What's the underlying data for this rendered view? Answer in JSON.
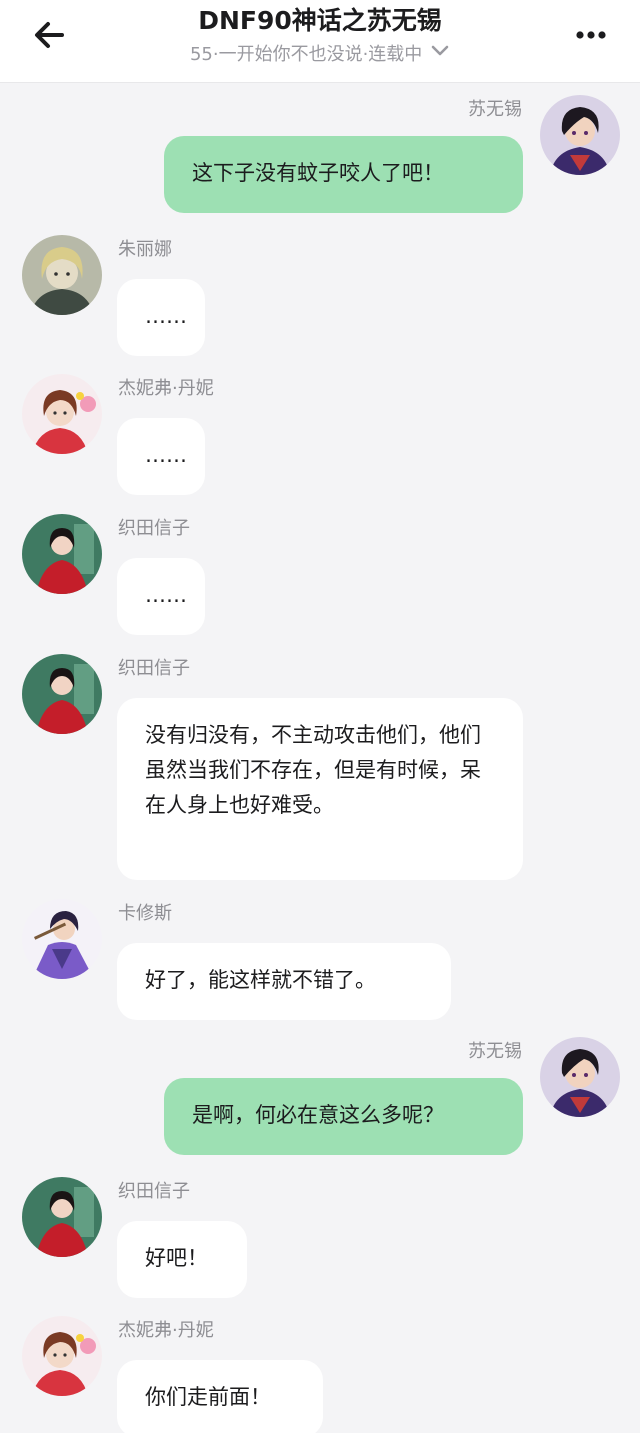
{
  "header": {
    "title": "DNF90神话之苏无锡",
    "subtitle": "55·一开始你不也没说·连载中"
  },
  "colors": {
    "self_bubble": "#9de0b3",
    "other_bubble": "#ffffff",
    "background": "#f4f4f6"
  },
  "messages": [
    {
      "sender": "苏无锡",
      "text": "这下子没有蚊子咬人了吧！",
      "side": "right",
      "avatar": "avatar-suwuxi"
    },
    {
      "sender": "朱丽娜",
      "text": "……",
      "side": "left",
      "avatar": "avatar-zhulina"
    },
    {
      "sender": "杰妮弗·丹妮",
      "text": "……",
      "side": "left",
      "avatar": "avatar-jennifer"
    },
    {
      "sender": "织田信子",
      "text": "……",
      "side": "left",
      "avatar": "avatar-nobuko"
    },
    {
      "sender": "织田信子",
      "text": "没有归没有，不主动攻击他们，他们虽然当我们不存在，但是有时候，呆在人身上也好难受。",
      "side": "left",
      "avatar": "avatar-nobuko"
    },
    {
      "sender": "卡修斯",
      "text": "好了，能这样就不错了。",
      "side": "left",
      "avatar": "avatar-cassius"
    },
    {
      "sender": "苏无锡",
      "text": "是啊，何必在意这么多呢？",
      "side": "right",
      "avatar": "avatar-suwuxi"
    },
    {
      "sender": "织田信子",
      "text": "好吧！",
      "side": "left",
      "avatar": "avatar-nobuko"
    },
    {
      "sender": "杰妮弗·丹妮",
      "text": "你们走前面！",
      "side": "left",
      "avatar": "avatar-jennifer"
    }
  ]
}
